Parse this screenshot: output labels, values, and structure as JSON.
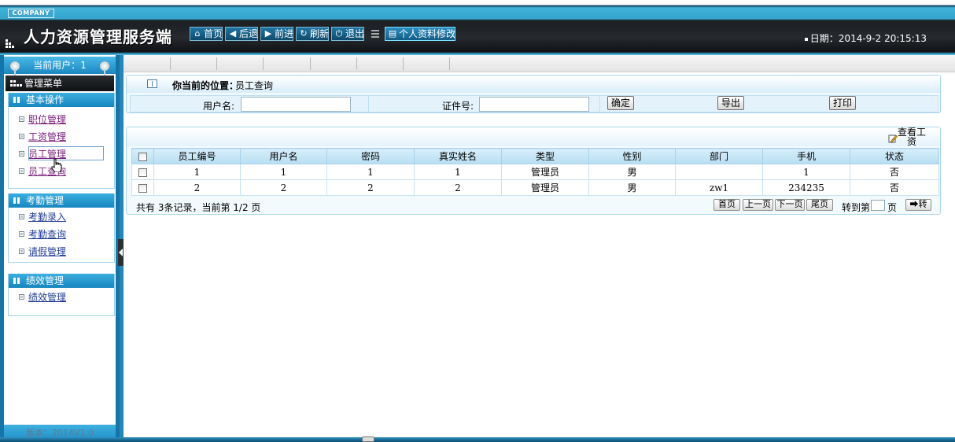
{
  "header": {
    "company": "COMPANY",
    "title": "人力资源管理服务端",
    "toolbar": [
      {
        "label": "首页",
        "icon": "home-icon"
      },
      {
        "label": "后退",
        "icon": "arrow-left-icon"
      },
      {
        "label": "前进",
        "icon": "arrow-right-icon"
      },
      {
        "label": "刷新",
        "icon": "refresh-icon"
      },
      {
        "label": "退出",
        "icon": "power-icon"
      }
    ],
    "profile_label": "个人资料修改",
    "date_label": "日期",
    "date_value": "2014-9-2 20:15:13"
  },
  "sidebar": {
    "current_user_label": "当前用户",
    "current_user": "1",
    "menu_title": "管理菜单",
    "groups": [
      {
        "title": "基本操作",
        "items": [
          {
            "label": "职位管理",
            "visited": true
          },
          {
            "label": "工资管理",
            "visited": true
          },
          {
            "label": "员工管理",
            "visited": true,
            "active": true
          },
          {
            "label": "员工查询",
            "visited": true
          }
        ]
      },
      {
        "title": "考勤管理",
        "items": [
          {
            "label": "考勤录入"
          },
          {
            "label": "考勤查询"
          },
          {
            "label": "请假管理"
          }
        ]
      },
      {
        "title": "绩效管理",
        "items": [
          {
            "label": "绩效管理"
          }
        ]
      }
    ],
    "version": "版本：2014V1.0"
  },
  "location": {
    "label": "你当前的位置：",
    "value": "员工查询"
  },
  "search": {
    "username_label": "用户名:",
    "username_value": "",
    "idcard_label": "证件号:",
    "idcard_value": "",
    "confirm_label": "确定",
    "export_label": "导出",
    "print_label": "打印"
  },
  "grid": {
    "action_label": "查看工资",
    "columns": [
      "员工编号",
      "用户名",
      "密码",
      "真实姓名",
      "类型",
      "性别",
      "部门",
      "手机",
      "状态"
    ],
    "rows": [
      [
        "1",
        "1",
        "1",
        "1",
        "管理员",
        "男",
        "",
        "1",
        "否"
      ],
      [
        "2",
        "2",
        "2",
        "2",
        "管理员",
        "男",
        "zw1",
        "234235",
        "否"
      ]
    ]
  },
  "pager": {
    "summary": "共有 3条记录，当前第 1/2 页",
    "first": "首页",
    "prev": "上一页",
    "next": "下一页",
    "last": "尾页",
    "goto_label": "转到第",
    "page_unit": "页",
    "go": "转"
  }
}
